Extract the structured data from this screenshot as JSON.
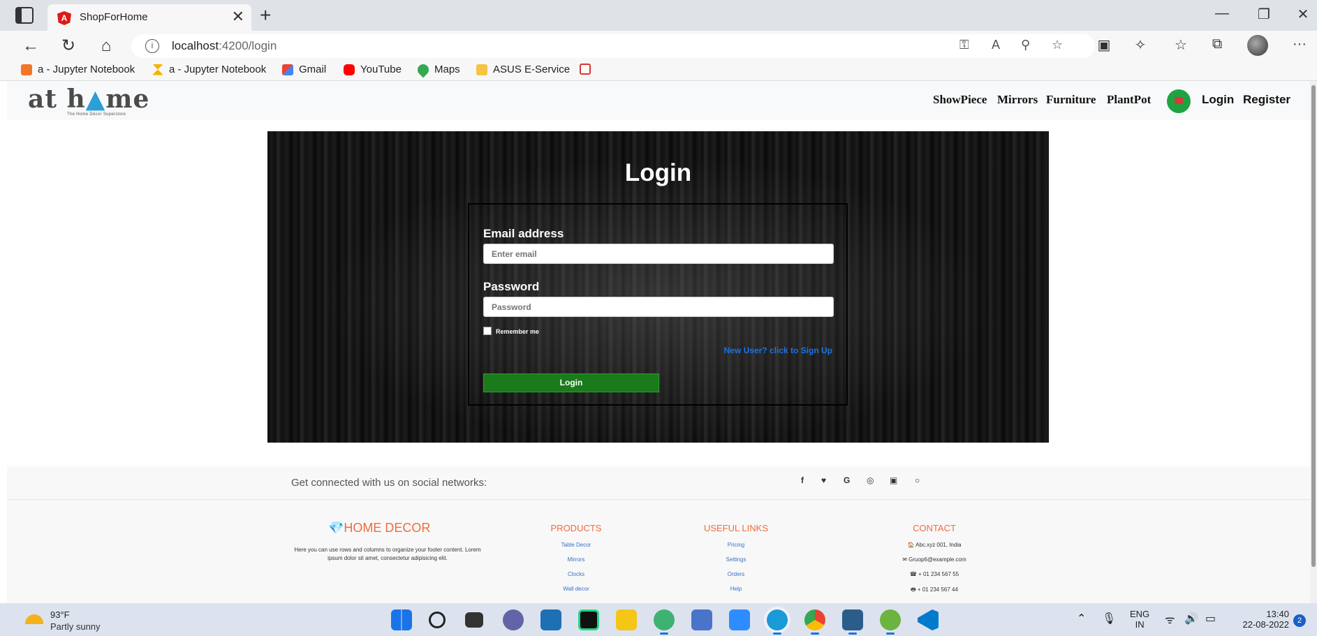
{
  "browser": {
    "tab_title": "ShopForHome",
    "tab_close": "✕",
    "new_tab": "+",
    "url_host": "localhost",
    "url_path": ":4200/login",
    "window_controls": {
      "minimize": "—",
      "restore": "❐",
      "close": "✕"
    },
    "nav_icons": {
      "back": "←",
      "refresh": "↻",
      "home": "⌂",
      "menu": "···"
    },
    "bookmarks": [
      {
        "label": "a - Jupyter Notebook",
        "color": "#f37626"
      },
      {
        "label": "a - Jupyter Notebook",
        "color": "#f5b400"
      },
      {
        "label": "Gmail",
        "color": "#ea4335"
      },
      {
        "label": "YouTube",
        "color": "#ff0000"
      },
      {
        "label": "Maps",
        "color": "#34a853"
      },
      {
        "label": "ASUS E-Service",
        "color": "#f4c542"
      }
    ]
  },
  "navbar": {
    "logo_text_a": "at h",
    "logo_text_o": "▲",
    "logo_text_b": "me",
    "logo_tagline": "The Home Décor Superstore",
    "links": [
      "ShowPiece",
      "Mirrors",
      "Furniture",
      "PlantPot"
    ],
    "login": "Login",
    "register": "Register"
  },
  "login_form": {
    "title": "Login",
    "email_label": "Email address",
    "email_placeholder": "Enter email",
    "password_label": "Password",
    "password_placeholder": "Password",
    "remember_label": "Remember me",
    "signup_link": "New User? click to Sign Up",
    "submit_label": "Login"
  },
  "social": {
    "text": "Get connected with us on social networks:",
    "icons": [
      "f",
      "♥",
      "G",
      "◎",
      "▣",
      "○"
    ]
  },
  "footer": {
    "brand": "💎HOME DECOR",
    "description": "Here you can use rows and columns to organize your footer content. Lorem ipsum dolor sit amet, consectetur adipisicing elit.",
    "products": {
      "heading": "PRODUCTS",
      "items": [
        "Table Decor",
        "Mirrors",
        "Clocks",
        "Wall decor"
      ]
    },
    "useful_links": {
      "heading": "USEFUL LINKS",
      "items": [
        "Pricing",
        "Settings",
        "Orders",
        "Help"
      ]
    },
    "contact": {
      "heading": "CONTACT",
      "items": [
        "🏠 Abc.xyz 001, India",
        "✉ Gruop6@example.com",
        "☎ + 01 234 567 55",
        "🖶 + 01 234 567 44"
      ]
    }
  },
  "taskbar": {
    "weather_temp": "93°F",
    "weather_desc": "Partly sunny",
    "lang_top": "ENG",
    "lang_bottom": "IN",
    "time": "13:40",
    "date": "22-08-2022",
    "notification_count": "2"
  },
  "colors": {
    "accent_orange": "#ef6c3b",
    "link_blue": "#1a73e8",
    "login_button": "#1b7a1b",
    "cart_green": "#1ea341"
  }
}
